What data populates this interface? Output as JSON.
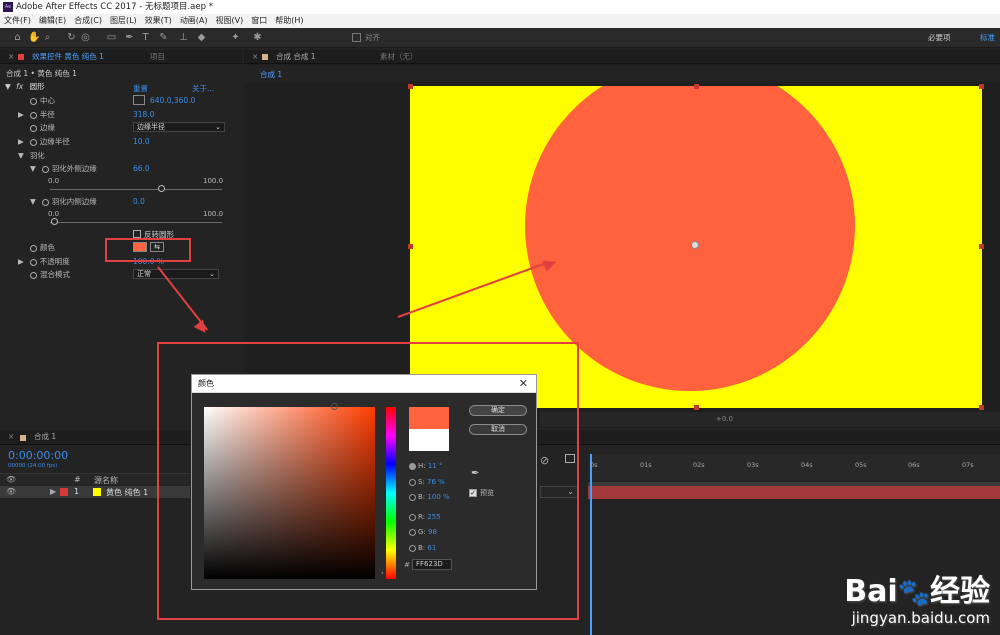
{
  "app": {
    "logo": "Ae",
    "title": "Adobe After Effects CC 2017 - 无标题项目.aep *"
  },
  "menu": [
    "文件(F)",
    "编辑(E)",
    "合成(C)",
    "图层(L)",
    "效果(T)",
    "动画(A)",
    "视图(V)",
    "窗口",
    "帮助(H)"
  ],
  "toolbar": {
    "snap_label": "对齐",
    "workspace_required": "必要项",
    "workspace_standard": "标准"
  },
  "effects_panel": {
    "tab_label": "效果控件 黄色 纯色 1",
    "tab_project": "项目",
    "layer_path": "合成 1 • 黄色 纯色 1",
    "effect_name": "圆形",
    "reset": "重置",
    "about": "关于...",
    "fx": "fx",
    "props": {
      "center_label": "中心",
      "center_value": "640.0,360.0",
      "radius_label": "半径",
      "radius_value": "318.0",
      "edge_label": "边缘",
      "edge_value": "边缘半径",
      "edge_radius_label": "边缘半径",
      "edge_radius_value": "10.0",
      "feather_label": "羽化",
      "feather_outer_label": "羽化外侧边缘",
      "feather_outer_value": "66.0",
      "feather_outer_min": "0.0",
      "feather_outer_max": "100.0",
      "feather_inner_label": "羽化内侧边缘",
      "feather_inner_value": "0.0",
      "feather_inner_min": "0.0",
      "feather_inner_max": "100.0",
      "invert_label": "反转圆形",
      "color_label": "颜色",
      "opacity_label": "不透明度",
      "opacity_value": "100.0 %",
      "blend_label": "混合模式",
      "blend_value": "正常"
    }
  },
  "comp_panel": {
    "tab_label": "合成 合成 1",
    "footage_tab": "素材（无）",
    "sub_tab": "合成 1",
    "zoom_readout": "+0.0"
  },
  "timeline": {
    "tab_label": "合成 1",
    "timecode": "0:00:00:00",
    "frames": "00000 (24.00 fps)",
    "col_hash": "#",
    "col_source": "源名称",
    "layer_num": "1",
    "layer_name": "黄色 纯色 1",
    "ticks": [
      "0s",
      "01s",
      "02s",
      "03s",
      "04s",
      "05s",
      "06s",
      "07s"
    ]
  },
  "color_dialog": {
    "title": "颜色",
    "ok": "确定",
    "cancel": "取消",
    "h_label": "H:",
    "h_value": "11 °",
    "s_label": "S:",
    "s_value": "76 %",
    "b_label": "B:",
    "b_value": "100 %",
    "r_label": "R:",
    "r_value": "255",
    "g_label": "G:",
    "g_value": "98",
    "b2_label": "B:",
    "b2_value": "61",
    "hex_label": "#",
    "hex_value": "FF623D",
    "preview_label": "预览"
  },
  "colors": {
    "fill_color": "#ff623d",
    "canvas_bg": "#ffff00",
    "accent_blue": "#3b8de8",
    "annotation_red": "#e04040"
  },
  "watermark": {
    "brand": "Bai",
    "brand2": "经验",
    "url": "jingyan.baidu.com"
  }
}
